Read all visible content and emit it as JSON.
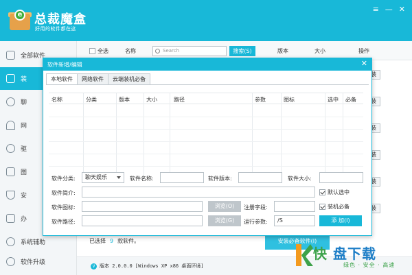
{
  "app": {
    "title": "总裁魔盒",
    "slogan": "好用的软件都在这",
    "window_controls": [
      "≡",
      "—",
      "✕"
    ]
  },
  "sidebar": {
    "items": [
      {
        "label": "全部软件",
        "icon": "grid-icon"
      },
      {
        "label": "装",
        "icon": "monitor-icon"
      },
      {
        "label": "聊",
        "icon": "chat-icon"
      },
      {
        "label": "网",
        "icon": "wifi-icon"
      },
      {
        "label": "驱",
        "icon": "gear-icon"
      },
      {
        "label": "图",
        "icon": "image-icon"
      },
      {
        "label": "安",
        "icon": "shield-icon"
      },
      {
        "label": "办",
        "icon": "document-icon"
      },
      {
        "label": "系统辅助",
        "icon": "cog-icon"
      },
      {
        "label": "软件升级",
        "icon": "refresh-icon"
      }
    ],
    "active_index": 1
  },
  "toolbar": {
    "select_all": "全选",
    "name_col": "名称",
    "search_placeholder": "Search",
    "search_button": "搜索(S)",
    "version_col": "版本",
    "size_col": "大小",
    "action_col": "操作"
  },
  "install_button_label": "装",
  "footer": {
    "selected_prefix": "已选择",
    "selected_count": "9",
    "selected_suffix": "款软件。",
    "install_button": "安装必备软件(I)",
    "version": "版本 2.0.0.0 [Windows XP x86 桌面环境]"
  },
  "watermark": {
    "title_a": "快",
    "title_b": "盘下载",
    "subtitle": "绿色 · 安全 · 高速"
  },
  "modal": {
    "title": "软件新增/编辑",
    "close": "✕",
    "tabs": [
      "本地软件",
      "网络软件",
      "云端装机必备"
    ],
    "active_tab": 0,
    "columns": [
      "名称",
      "分类",
      "版本",
      "大小",
      "路径",
      "参数",
      "图标",
      "选中",
      "必备"
    ],
    "form": {
      "category_label": "软件分类:",
      "category_value": "聊天娱乐",
      "name_label": "软件名称:",
      "name_value": "",
      "version_label": "软件版本:",
      "version_value": "",
      "size_label": "软件大小:",
      "size_value": "",
      "intro_label": "软件简介:",
      "intro_value": "",
      "default_checked_label": "默认选中",
      "icon_label": "软件图标:",
      "icon_value": "",
      "browse_icon": "浏览(O)",
      "reg_label": "注册字段:",
      "reg_value": "",
      "required_label": "装机必备",
      "path_label": "软件路径:",
      "path_value": "",
      "browse_path": "浏览(G)",
      "params_label": "运行参数:",
      "params_value": "/S",
      "add_button": "添 加(I)"
    }
  }
}
